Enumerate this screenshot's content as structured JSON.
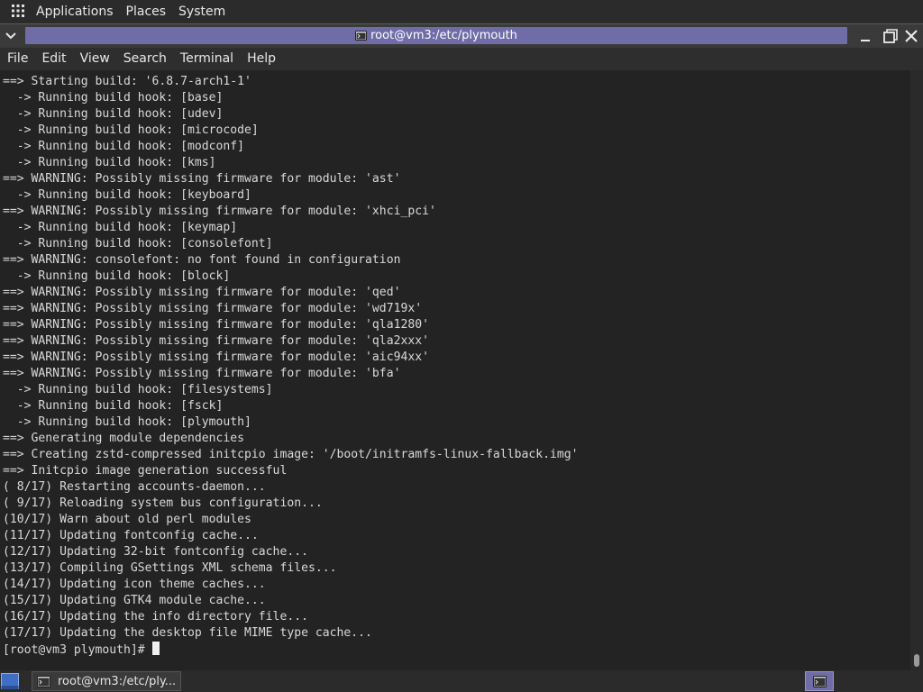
{
  "top_panel": {
    "menus": [
      "Applications",
      "Places",
      "System"
    ]
  },
  "window": {
    "title": "root@vm3:/etc/plymouth",
    "menubar": [
      "File",
      "Edit",
      "View",
      "Search",
      "Terminal",
      "Help"
    ]
  },
  "terminal": {
    "lines": [
      "==> Starting build: '6.8.7-arch1-1'",
      "  -> Running build hook: [base]",
      "  -> Running build hook: [udev]",
      "  -> Running build hook: [microcode]",
      "  -> Running build hook: [modconf]",
      "  -> Running build hook: [kms]",
      "==> WARNING: Possibly missing firmware for module: 'ast'",
      "  -> Running build hook: [keyboard]",
      "==> WARNING: Possibly missing firmware for module: 'xhci_pci'",
      "  -> Running build hook: [keymap]",
      "  -> Running build hook: [consolefont]",
      "==> WARNING: consolefont: no font found in configuration",
      "  -> Running build hook: [block]",
      "==> WARNING: Possibly missing firmware for module: 'qed'",
      "==> WARNING: Possibly missing firmware for module: 'wd719x'",
      "==> WARNING: Possibly missing firmware for module: 'qla1280'",
      "==> WARNING: Possibly missing firmware for module: 'qla2xxx'",
      "==> WARNING: Possibly missing firmware for module: 'aic94xx'",
      "==> WARNING: Possibly missing firmware for module: 'bfa'",
      "  -> Running build hook: [filesystems]",
      "  -> Running build hook: [fsck]",
      "  -> Running build hook: [plymouth]",
      "==> Generating module dependencies",
      "==> Creating zstd-compressed initcpio image: '/boot/initramfs-linux-fallback.img'",
      "==> Initcpio image generation successful",
      "( 8/17) Restarting accounts-daemon...",
      "( 9/17) Reloading system bus configuration...",
      "(10/17) Warn about old perl modules",
      "(11/17) Updating fontconfig cache...",
      "(12/17) Updating 32-bit fontconfig cache...",
      "(13/17) Compiling GSettings XML schema files...",
      "(14/17) Updating icon theme caches...",
      "(15/17) Updating GTK4 module cache...",
      "(16/17) Updating the info directory file...",
      "(17/17) Updating the desktop file MIME type cache..."
    ],
    "prompt": "[root@vm3 plymouth]# "
  },
  "taskbar": {
    "window_label": "root@vm3:/etc/ply..."
  },
  "icons": {
    "top_panel": "applications-grid-icon",
    "titlebar_left": "chevron-down-icon",
    "titlebar_title": "terminal-icon",
    "minimize": "minimize-icon",
    "maximize": "maximize-icon",
    "close": "close-icon",
    "show_desktop": "show-desktop-icon",
    "taskbar_item": "terminal-icon",
    "workspace": "terminal-icon"
  },
  "colors": {
    "accent": "#6f6ca7",
    "terminal_bg": "#232323",
    "terminal_fg": "#d9d9d9",
    "panel_bg": "#2b2b2b"
  }
}
